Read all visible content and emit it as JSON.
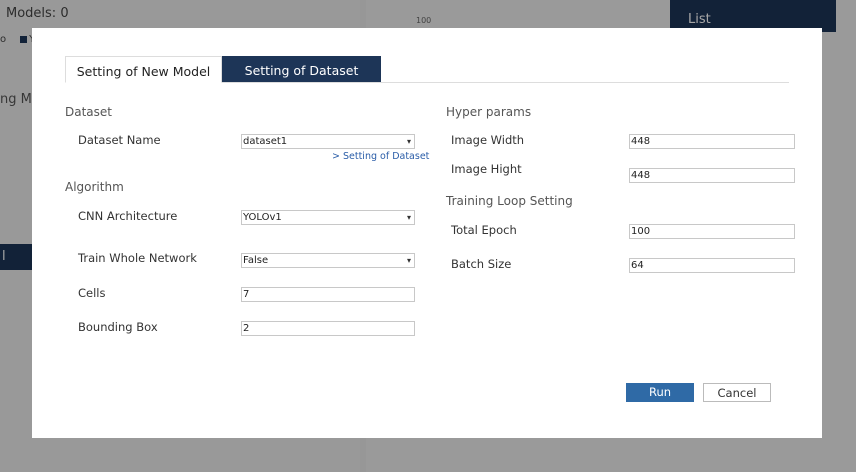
{
  "background": {
    "models_count": "Models: 0",
    "legend_fragment": "o",
    "legend_label": "Y",
    "side_text": "ng M",
    "side_tab": "l Deta",
    "chart_tick": "100",
    "list_label": "List"
  },
  "modal": {
    "tabs": [
      {
        "label": "Setting of New Model",
        "active": true
      },
      {
        "label": "Setting of Dataset",
        "active": false
      }
    ],
    "left": {
      "dataset_section": "Dataset",
      "dataset_name_label": "Dataset Name",
      "dataset_name_value": "dataset1",
      "dataset_link": "> Setting of Dataset",
      "algorithm_section": "Algorithm",
      "cnn_label": "CNN Architecture",
      "cnn_value": "YOLOv1",
      "train_whole_label": "Train Whole Network",
      "train_whole_value": "False",
      "cells_label": "Cells",
      "cells_value": "7",
      "bbox_label": "Bounding Box",
      "bbox_value": "2"
    },
    "right": {
      "hyper_section": "Hyper params",
      "image_width_label": "Image Width",
      "image_width_value": "448",
      "image_height_label": "Image Hight",
      "image_height_value": "448",
      "loop_section": "Training Loop Setting",
      "total_epoch_label": "Total Epoch",
      "total_epoch_value": "100",
      "batch_size_label": "Batch Size",
      "batch_size_value": "64"
    },
    "buttons": {
      "run": "Run",
      "cancel": "Cancel"
    },
    "caret": "▾"
  },
  "colors": {
    "navy": "#1d3557",
    "run_button": "#2f6aa6",
    "link": "#2a5da8"
  }
}
